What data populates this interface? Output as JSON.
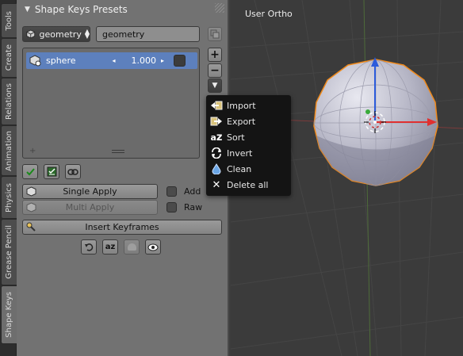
{
  "tabs": [
    {
      "label": "Tools",
      "active": false
    },
    {
      "label": "Create",
      "active": false
    },
    {
      "label": "Relations",
      "active": false
    },
    {
      "label": "Animation",
      "active": false
    },
    {
      "label": "Physics",
      "active": false
    },
    {
      "label": "Grease Pencil",
      "active": false
    },
    {
      "label": "Shape Keys",
      "active": true
    }
  ],
  "panel": {
    "title": "Shape Keys Presets",
    "preset_select": "geometry",
    "preset_name": "geometry",
    "shape_list": [
      {
        "name": "sphere",
        "value": "1.000"
      }
    ],
    "single_apply": "Single Apply",
    "multi_apply": "Multi Apply",
    "add_label": "Add",
    "raw_label": "Raw",
    "insert_keyframes": "Insert Keyframes"
  },
  "menu": {
    "items": [
      {
        "label": "Import",
        "icon": "import-icon"
      },
      {
        "label": "Export",
        "icon": "export-icon"
      },
      {
        "label": "Sort",
        "icon": "sort-az-icon"
      },
      {
        "label": "Invert",
        "icon": "invert-icon"
      },
      {
        "label": "Clean",
        "icon": "drop-icon"
      },
      {
        "label": "Delete all",
        "icon": "close-x-icon"
      }
    ]
  },
  "viewport": {
    "label": "User Ortho"
  },
  "colors": {
    "panel_bg": "#727272",
    "selection_blue": "#5d80bd",
    "menu_bg": "#141414",
    "viewport_bg": "#3b3b3b",
    "select_outline": "#f08a1c"
  }
}
